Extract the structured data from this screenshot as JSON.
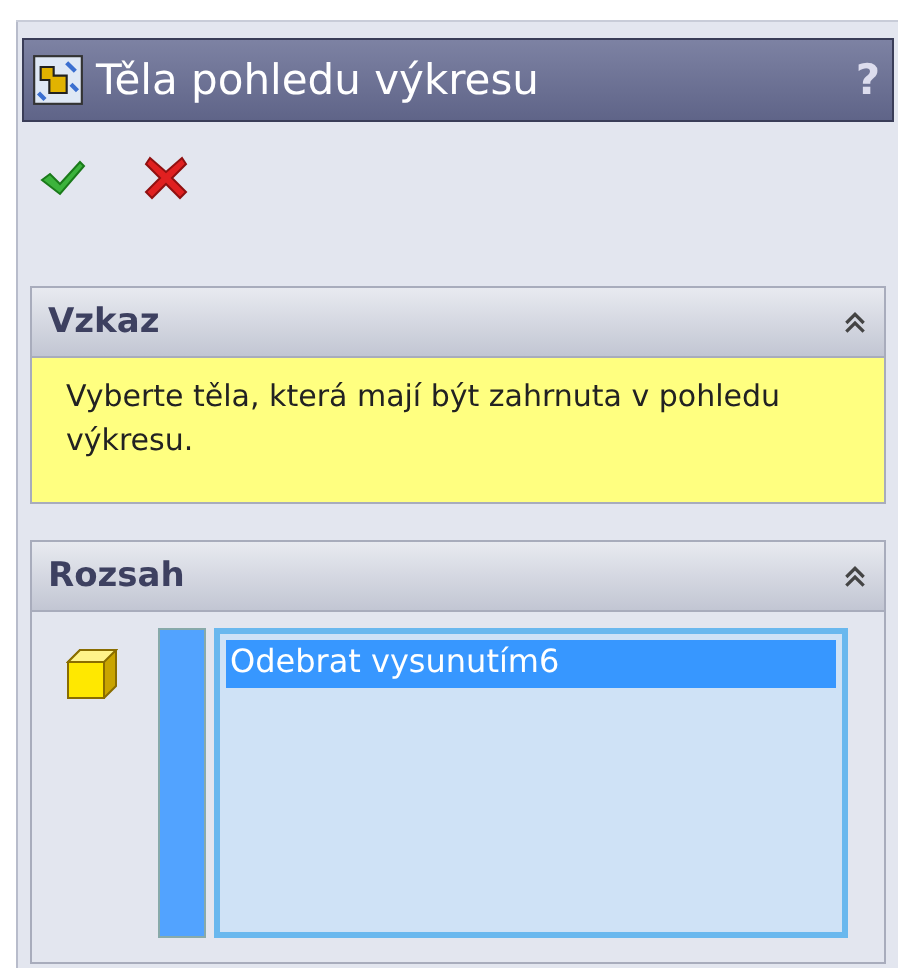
{
  "window": {
    "title": "Těla pohledu výkresu",
    "help": "?"
  },
  "actions": [
    {
      "kind": "ok"
    },
    {
      "kind": "cancel"
    }
  ],
  "groups": [
    {
      "title": "Vzkaz",
      "expanded": true,
      "kind": "message",
      "text": "Vyberte těla, která mají být zahrnuta v pohledu výkresu."
    },
    {
      "title": "Rozsah",
      "expanded": true,
      "kind": "selection",
      "items": [
        {
          "label": "Odebrat vysunutím6",
          "selected": true
        }
      ]
    }
  ]
}
